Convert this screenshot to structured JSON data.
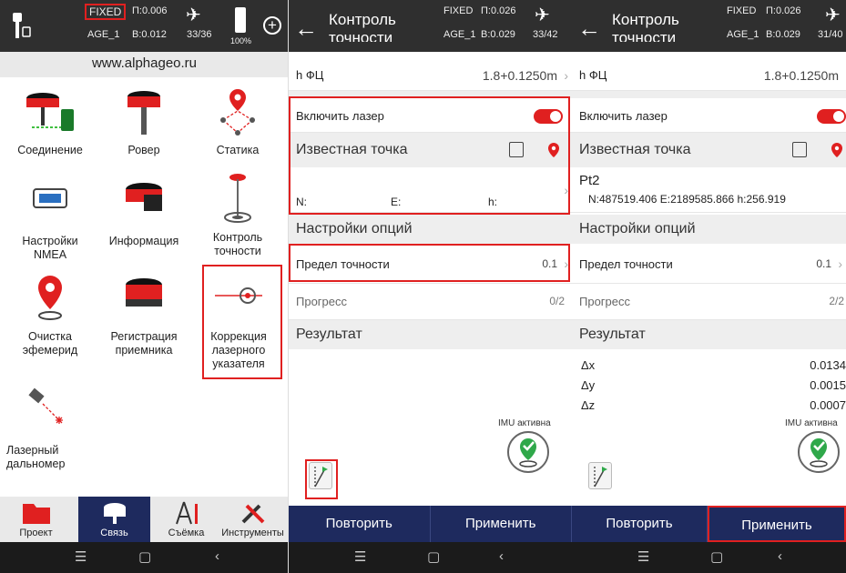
{
  "colors": {
    "accent_red": "#e02020",
    "navy": "#1e2a5e",
    "status_bg": "#2f2f2f"
  },
  "status_p1": {
    "fix": "FIXED",
    "age": "AGE_1",
    "h": "П:0.006",
    "v": "В:0.012",
    "sats": "33/36",
    "battery": "100%"
  },
  "status_p2": {
    "fix": "FIXED",
    "age": "AGE_1",
    "h": "П:0.026",
    "v": "В:0.029",
    "sats": "33/42"
  },
  "status_p3": {
    "fix": "FIXED",
    "age": "AGE_1",
    "h": "П:0.026",
    "v": "В:0.029",
    "sats": "31/40"
  },
  "panel1": {
    "site": "www.alphageo.ru",
    "items": [
      {
        "label": "Соединение",
        "icon": "receiver-phone-icon"
      },
      {
        "label": "Ровер",
        "icon": "rover-receiver-icon"
      },
      {
        "label": "Статика",
        "icon": "static-survey-icon"
      },
      {
        "label": "Настройки NMEA",
        "icon": "serial-port-icon"
      },
      {
        "label": "Информация",
        "icon": "receiver-info-icon"
      },
      {
        "label": "Контроль точности",
        "icon": "accuracy-control-icon"
      },
      {
        "label": "Очистка эфемерид",
        "icon": "location-pin-icon"
      },
      {
        "label": "Регистрация приемника",
        "icon": "receiver-register-icon"
      },
      {
        "label": "Коррекция лазерного указателя",
        "icon": "laser-target-icon"
      },
      {
        "label": "Лазерный дальномер",
        "icon": "laser-rangefinder-icon"
      }
    ],
    "tabs": [
      {
        "label": "Проект",
        "icon": "folder-icon"
      },
      {
        "label": "Связь",
        "icon": "receiver-icon"
      },
      {
        "label": "Съёмка",
        "icon": "compass-icon"
      },
      {
        "label": "Инструменты",
        "icon": "tools-icon"
      }
    ]
  },
  "screen": {
    "title": "Контроль точности",
    "h_label": "h ФЦ",
    "h_value": "1.8+0.1250m",
    "laser_label": "Включить лазер",
    "known_point": "Известная точка",
    "options": "Настройки опций",
    "accuracy_limit_label": "Предел точности",
    "accuracy_limit_value": "0.1",
    "progress_label": "Прогресс",
    "result": "Результат",
    "imu": "IMU активна",
    "repeat": "Повторить",
    "apply": "Применить"
  },
  "panel2": {
    "n_label": "N:",
    "e_label": "E:",
    "h_label": "h:",
    "progress_value": "0/2"
  },
  "panel3": {
    "point_name": "Pt2",
    "point_coords": "N:487519.406 E:2189585.866 h:256.919",
    "progress_value": "2/2",
    "dx_label": "Δx",
    "dx_value": "0.0134",
    "dy_label": "Δy",
    "dy_value": "0.0015",
    "dz_label": "Δz",
    "dz_value": "0.0007"
  },
  "nav": {
    "menu": "☰",
    "home": "▢",
    "back": "‹"
  }
}
